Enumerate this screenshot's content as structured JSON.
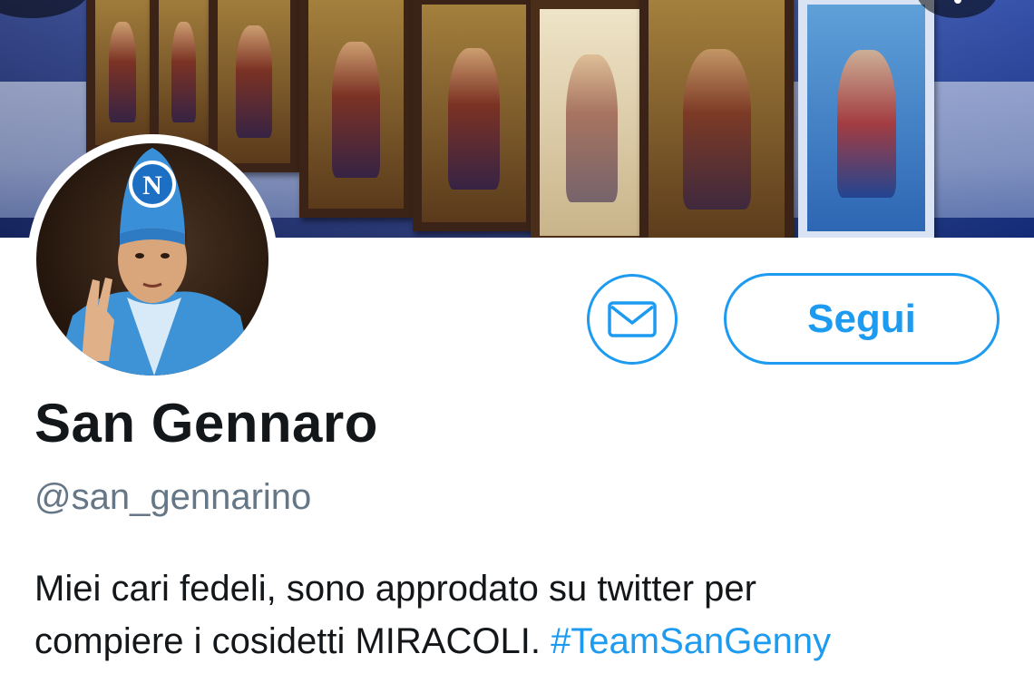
{
  "profile": {
    "name": "San Gennaro",
    "handle": "@san_gennarino",
    "bio_line1": "Miei cari fedeli, sono approdato su twitter per",
    "bio_line2_text": "compiere i cosidetti MIRACOLI. ",
    "bio_hashtag": "#TeamSanGenny"
  },
  "actions": {
    "message_icon": "mail-icon",
    "follow_label": "Segui"
  },
  "avatar": {
    "badge_letter": "N"
  },
  "colors": {
    "accent": "#1d9bf0",
    "name": "#14171a",
    "handle": "#657786"
  }
}
